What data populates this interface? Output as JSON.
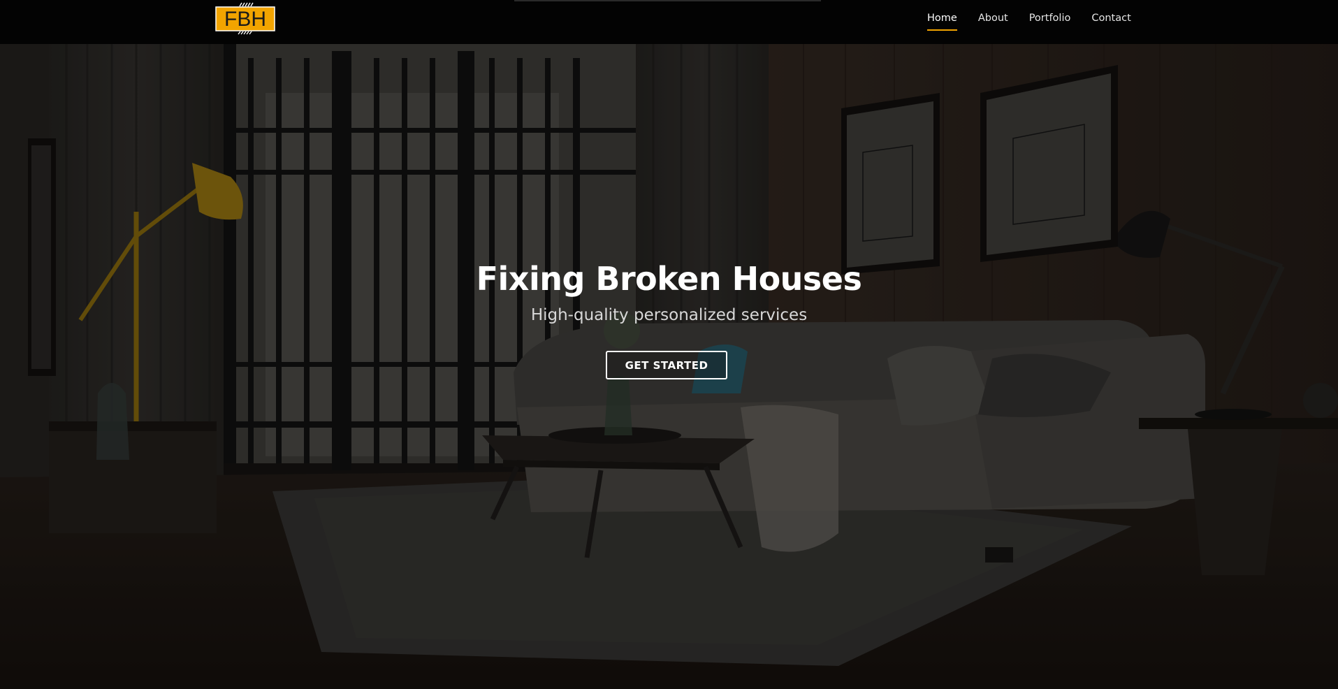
{
  "brand": {
    "logo_text": "FBH",
    "logo_color": "#f2a400"
  },
  "nav": {
    "items": [
      {
        "label": "Home",
        "active": true
      },
      {
        "label": "About",
        "active": false
      },
      {
        "label": "Portfolio",
        "active": false
      },
      {
        "label": "Contact",
        "active": false
      }
    ],
    "accent_color": "#f2a400"
  },
  "hero": {
    "title": "Fixing Broken Houses",
    "subtitle": "High-quality personalized services",
    "cta_label": "GET STARTED",
    "background": "dark-living-room-image"
  }
}
